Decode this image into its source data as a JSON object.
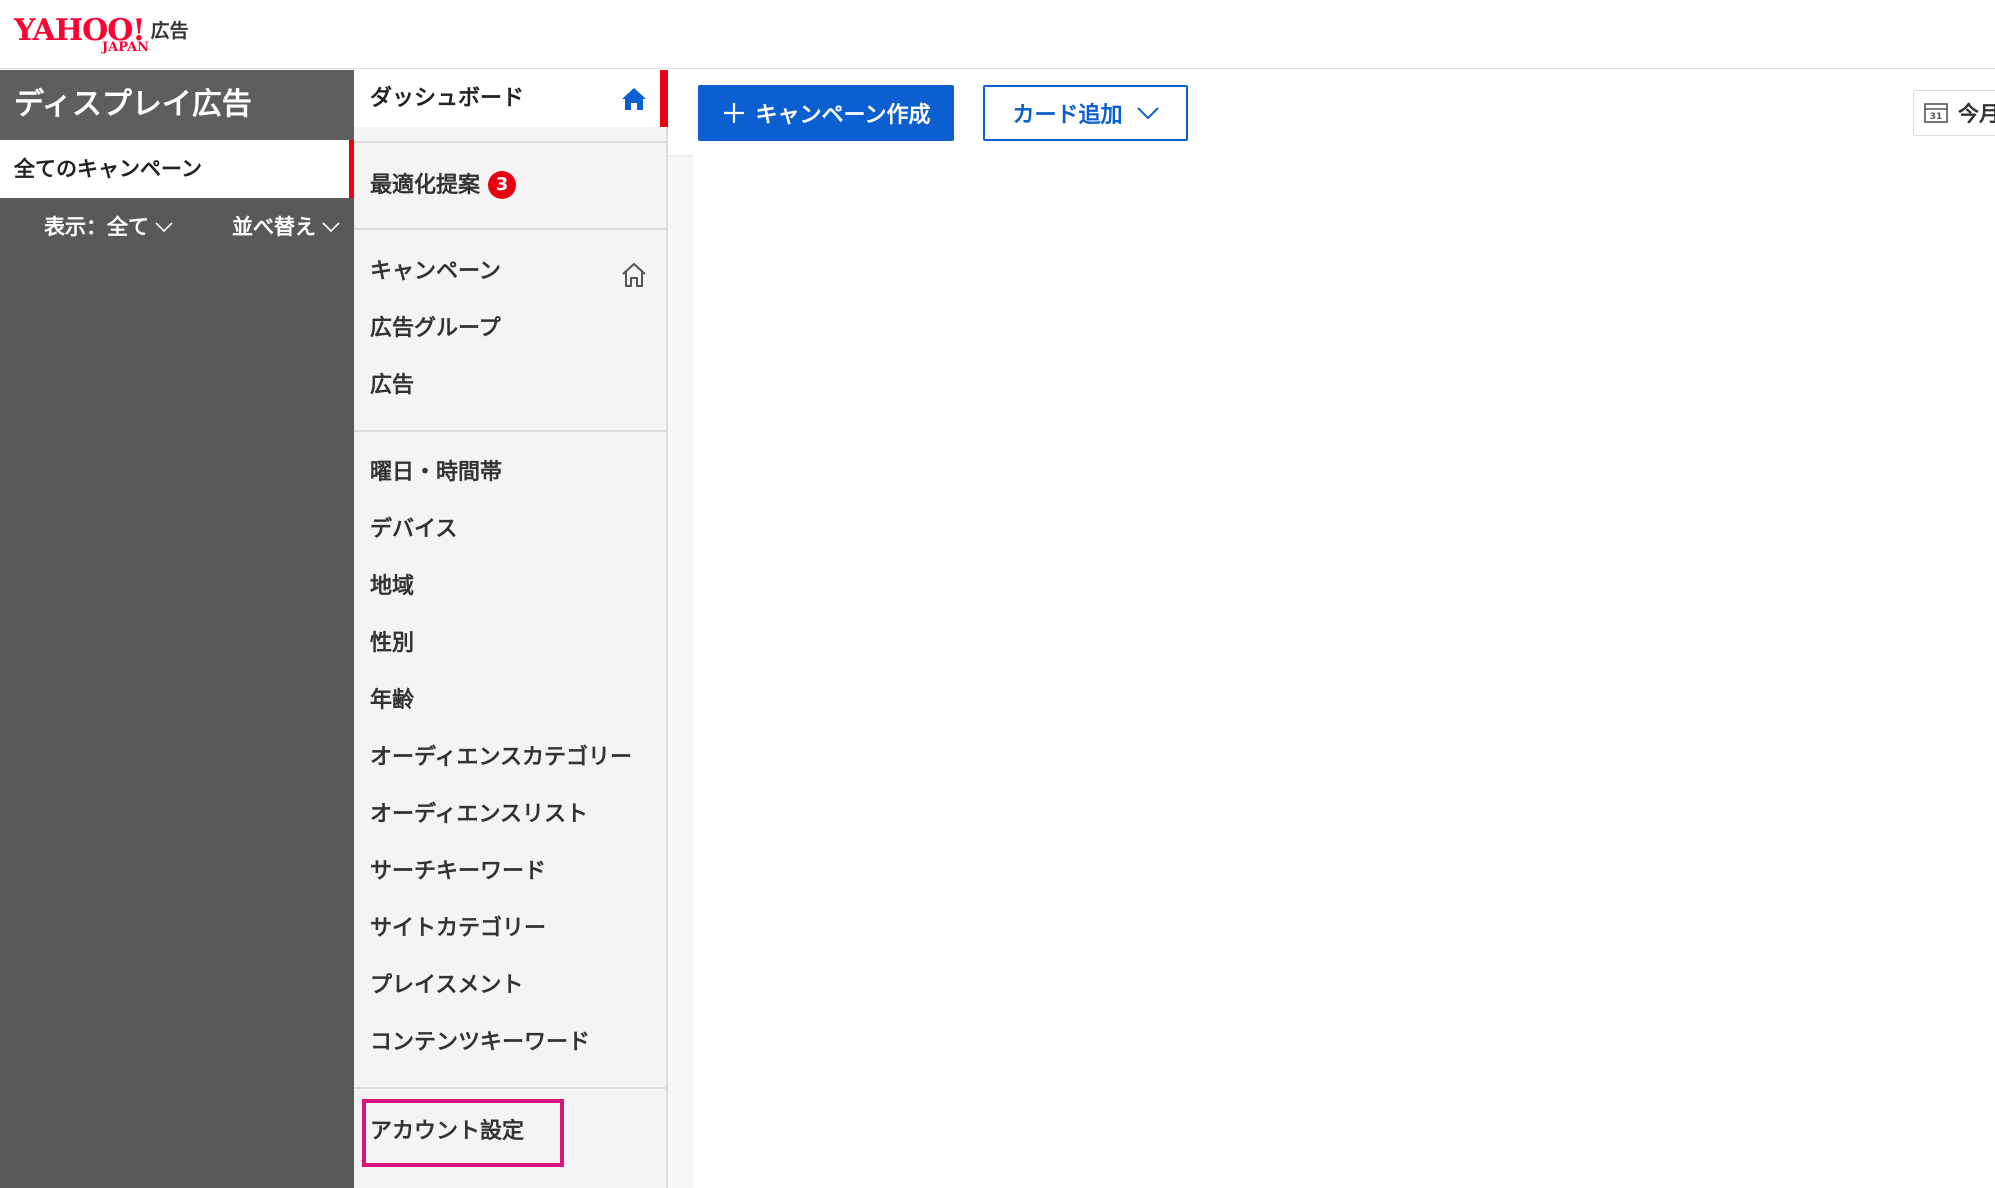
{
  "header": {
    "logo_text": "YAHOO!",
    "logo_sub": "JAPAN",
    "logo_service": "広告"
  },
  "left_panel": {
    "title": "ディスプレイ広告",
    "selected_item": "全てのキャンペーン",
    "filter_label": "表示：全て",
    "sort_label": "並べ替え"
  },
  "nav": {
    "dashboard": "ダッシュボード",
    "optimization": "最適化提案",
    "optimization_badge": "3",
    "items": [
      "キャンペーン",
      "広告グループ",
      "広告",
      "曜日・時間帯",
      "デバイス",
      "地域",
      "性別",
      "年齢",
      "オーディエンスカテゴリー",
      "オーディエンスリスト",
      "サーチキーワード",
      "サイトカテゴリー",
      "プレイスメント",
      "コンテンツキーワード"
    ],
    "account_settings": "アカウント設定"
  },
  "toolbar": {
    "create_campaign": "キャンペーン作成",
    "add_card": "カード追加",
    "date_range": "今月"
  },
  "colors": {
    "brand_red": "#e60012",
    "primary_blue": "#0b5fd0",
    "highlight_magenta": "#d8157b",
    "left_panel_bg": "#595959"
  }
}
